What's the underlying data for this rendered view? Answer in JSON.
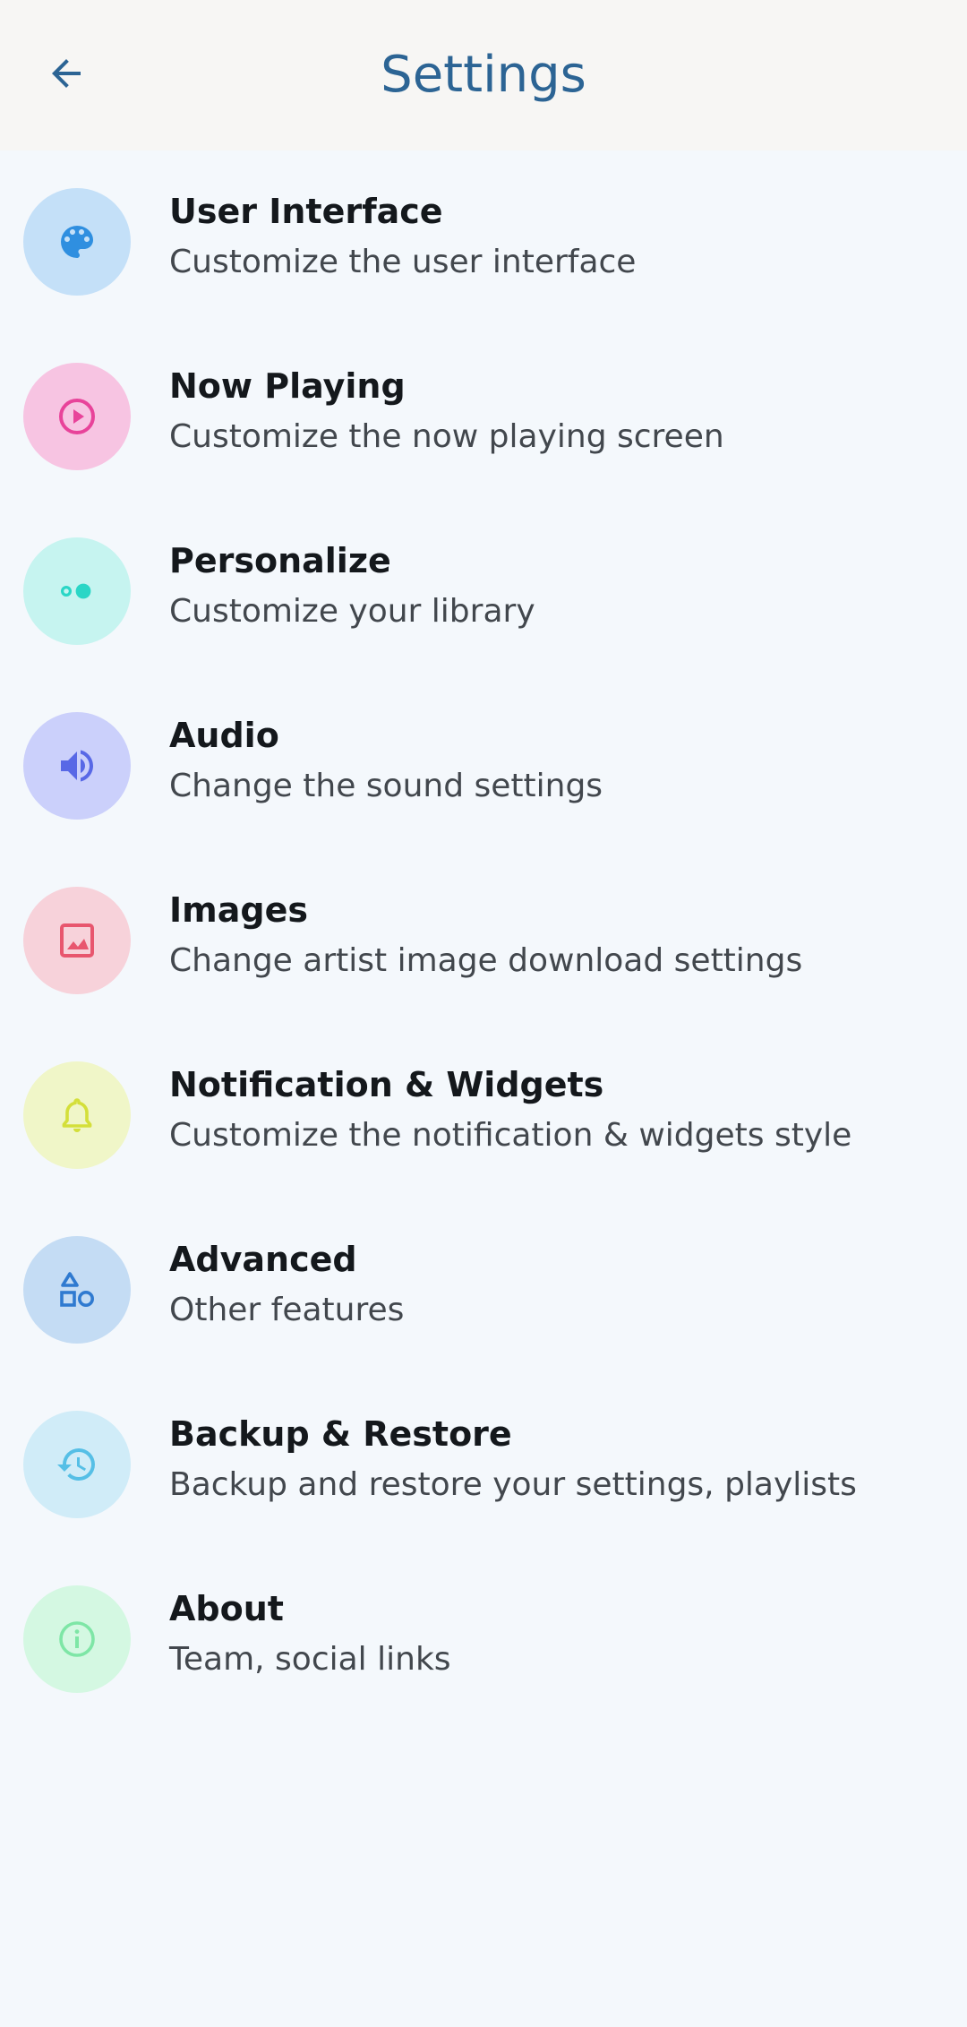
{
  "app_bar": {
    "title": "Settings",
    "back_icon": "arrow-back-icon",
    "title_color": "#2c6494"
  },
  "items": [
    {
      "name": "user-interface",
      "title": "User Interface",
      "subtitle": "Customize the user interface",
      "icon": "palette-icon",
      "bg": "#c4e0f8",
      "fg": "#2f8fe0"
    },
    {
      "name": "now-playing",
      "title": "Now Playing",
      "subtitle": "Customize the now playing screen",
      "icon": "play-circle-icon",
      "bg": "#f7c4e2",
      "fg": "#e8439a"
    },
    {
      "name": "personalize",
      "title": "Personalize",
      "subtitle": "Customize your library",
      "icon": "toggle-dots-icon",
      "bg": "#c6f4f0",
      "fg": "#2ad6c6"
    },
    {
      "name": "audio",
      "title": "Audio",
      "subtitle": "Change the sound settings",
      "icon": "volume-icon",
      "bg": "#cbd0fb",
      "fg": "#5868e6"
    },
    {
      "name": "images",
      "title": "Images",
      "subtitle": "Change artist image download settings",
      "icon": "image-icon",
      "bg": "#f7d2da",
      "fg": "#e8566e"
    },
    {
      "name": "notification-widgets",
      "title": "Notification & Widgets",
      "subtitle": "Customize the notification & widgets style",
      "icon": "bell-icon",
      "bg": "#f0f6c8",
      "fg": "#d4df3a"
    },
    {
      "name": "advanced",
      "title": "Advanced",
      "subtitle": "Other features",
      "icon": "shapes-icon",
      "bg": "#c4dcf4",
      "fg": "#2f7ad0"
    },
    {
      "name": "backup-restore",
      "title": "Backup & Restore",
      "subtitle": "Backup and restore your settings, playlists",
      "icon": "restore-icon",
      "bg": "#d0ecf8",
      "fg": "#56bfe6"
    },
    {
      "name": "about",
      "title": "About",
      "subtitle": "Team, social links",
      "icon": "info-icon",
      "bg": "#d4f8e2",
      "fg": "#7ee6a6"
    }
  ]
}
